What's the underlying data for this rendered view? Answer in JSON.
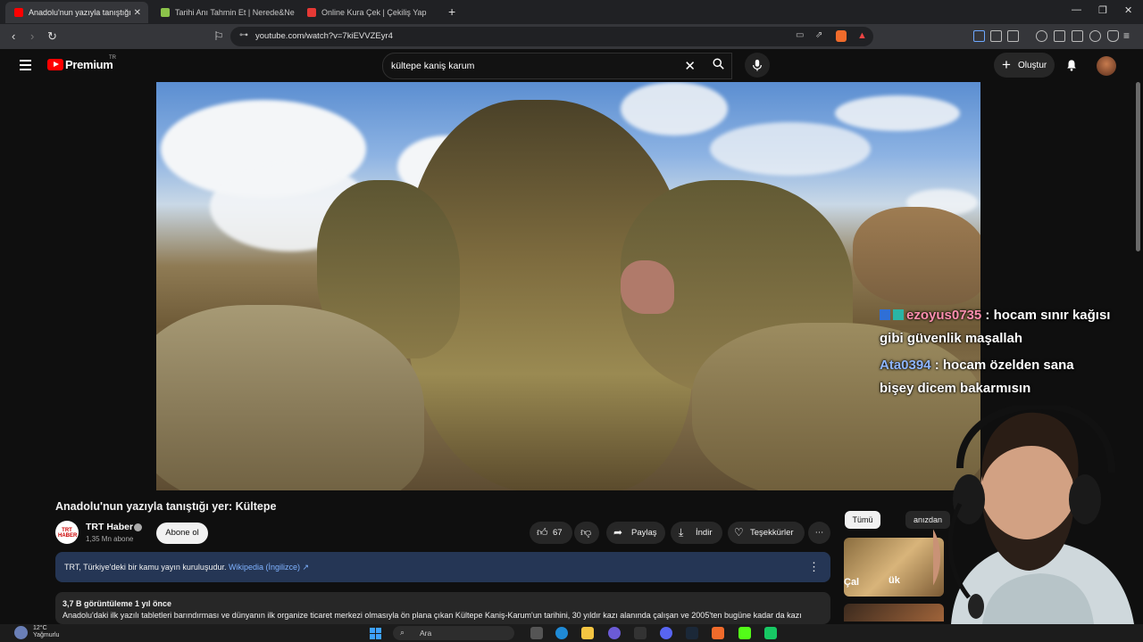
{
  "browser": {
    "tabs": [
      {
        "title": "Anadolu'nun yazıyla tanıştığı",
        "active": true,
        "favicon_color": "#ff0000"
      },
      {
        "title": "Tarihi Anı Tahmin Et | Nerede&Ne Za",
        "active": false,
        "favicon_color": "#8bc34a"
      },
      {
        "title": "Online Kura Çek | Çekiliş Yap",
        "active": false,
        "favicon_color": "#e53935"
      }
    ],
    "new_tab": "+",
    "url": "youtube.com/watch?v=7kiEVVZEyr4"
  },
  "youtube": {
    "brand": "Premium",
    "region": "TR",
    "search_query": "kültepe kaniş karum",
    "create_label": "Oluştur"
  },
  "chat": [
    {
      "user": "ezoyus0735",
      "sep": " : ",
      "message": "hocam sınır kağısı gibi güvenlik maşallah",
      "user_color": "#ff8fb0"
    },
    {
      "user": "Ata0394",
      "sep": " : ",
      "message": "hocam özelden sana bişey dicem bakarmısın",
      "user_color": "#8fb6ff"
    }
  ],
  "video": {
    "title": "Anadolu'nun yazıyla tanıştığı yer: Kültepe",
    "channel_name": "TRT Haber",
    "channel_logo_text": "TRT HABER",
    "subscribers": "1,35 Mn abone",
    "subscribe_label": "Abone ol",
    "likes": "67",
    "share_label": "Paylaş",
    "download_label": "İndir",
    "thanks_label": "Teşekkürler",
    "more": "⋯"
  },
  "info_panel": {
    "text": "TRT, Türkiye'deki bir kamu yayın kuruluşudur.",
    "link": "Wikipedia (İngilizce) ↗"
  },
  "description": {
    "views": "3,7 B görüntüleme",
    "age": "1 yıl önce",
    "text": "Anadolu'daki ilk yazılı tabletleri barındırması ve dünyanın ilk organize ticaret merkezi olmasıyla ön plana çıkan Kültepe Kaniş-Karum'un tarihini, 30 yıldır kazı alanında çalışan ve 2005'ten bugüne kadar da kazı"
  },
  "sidebar": {
    "chip_all": "Tümü",
    "chip_other": "anızdan",
    "thumb_text": "Çal",
    "thumb_text2": "ük"
  },
  "taskbar": {
    "temperature": "12°C",
    "condition": "Yağmurlu",
    "search_label": "Ara"
  }
}
